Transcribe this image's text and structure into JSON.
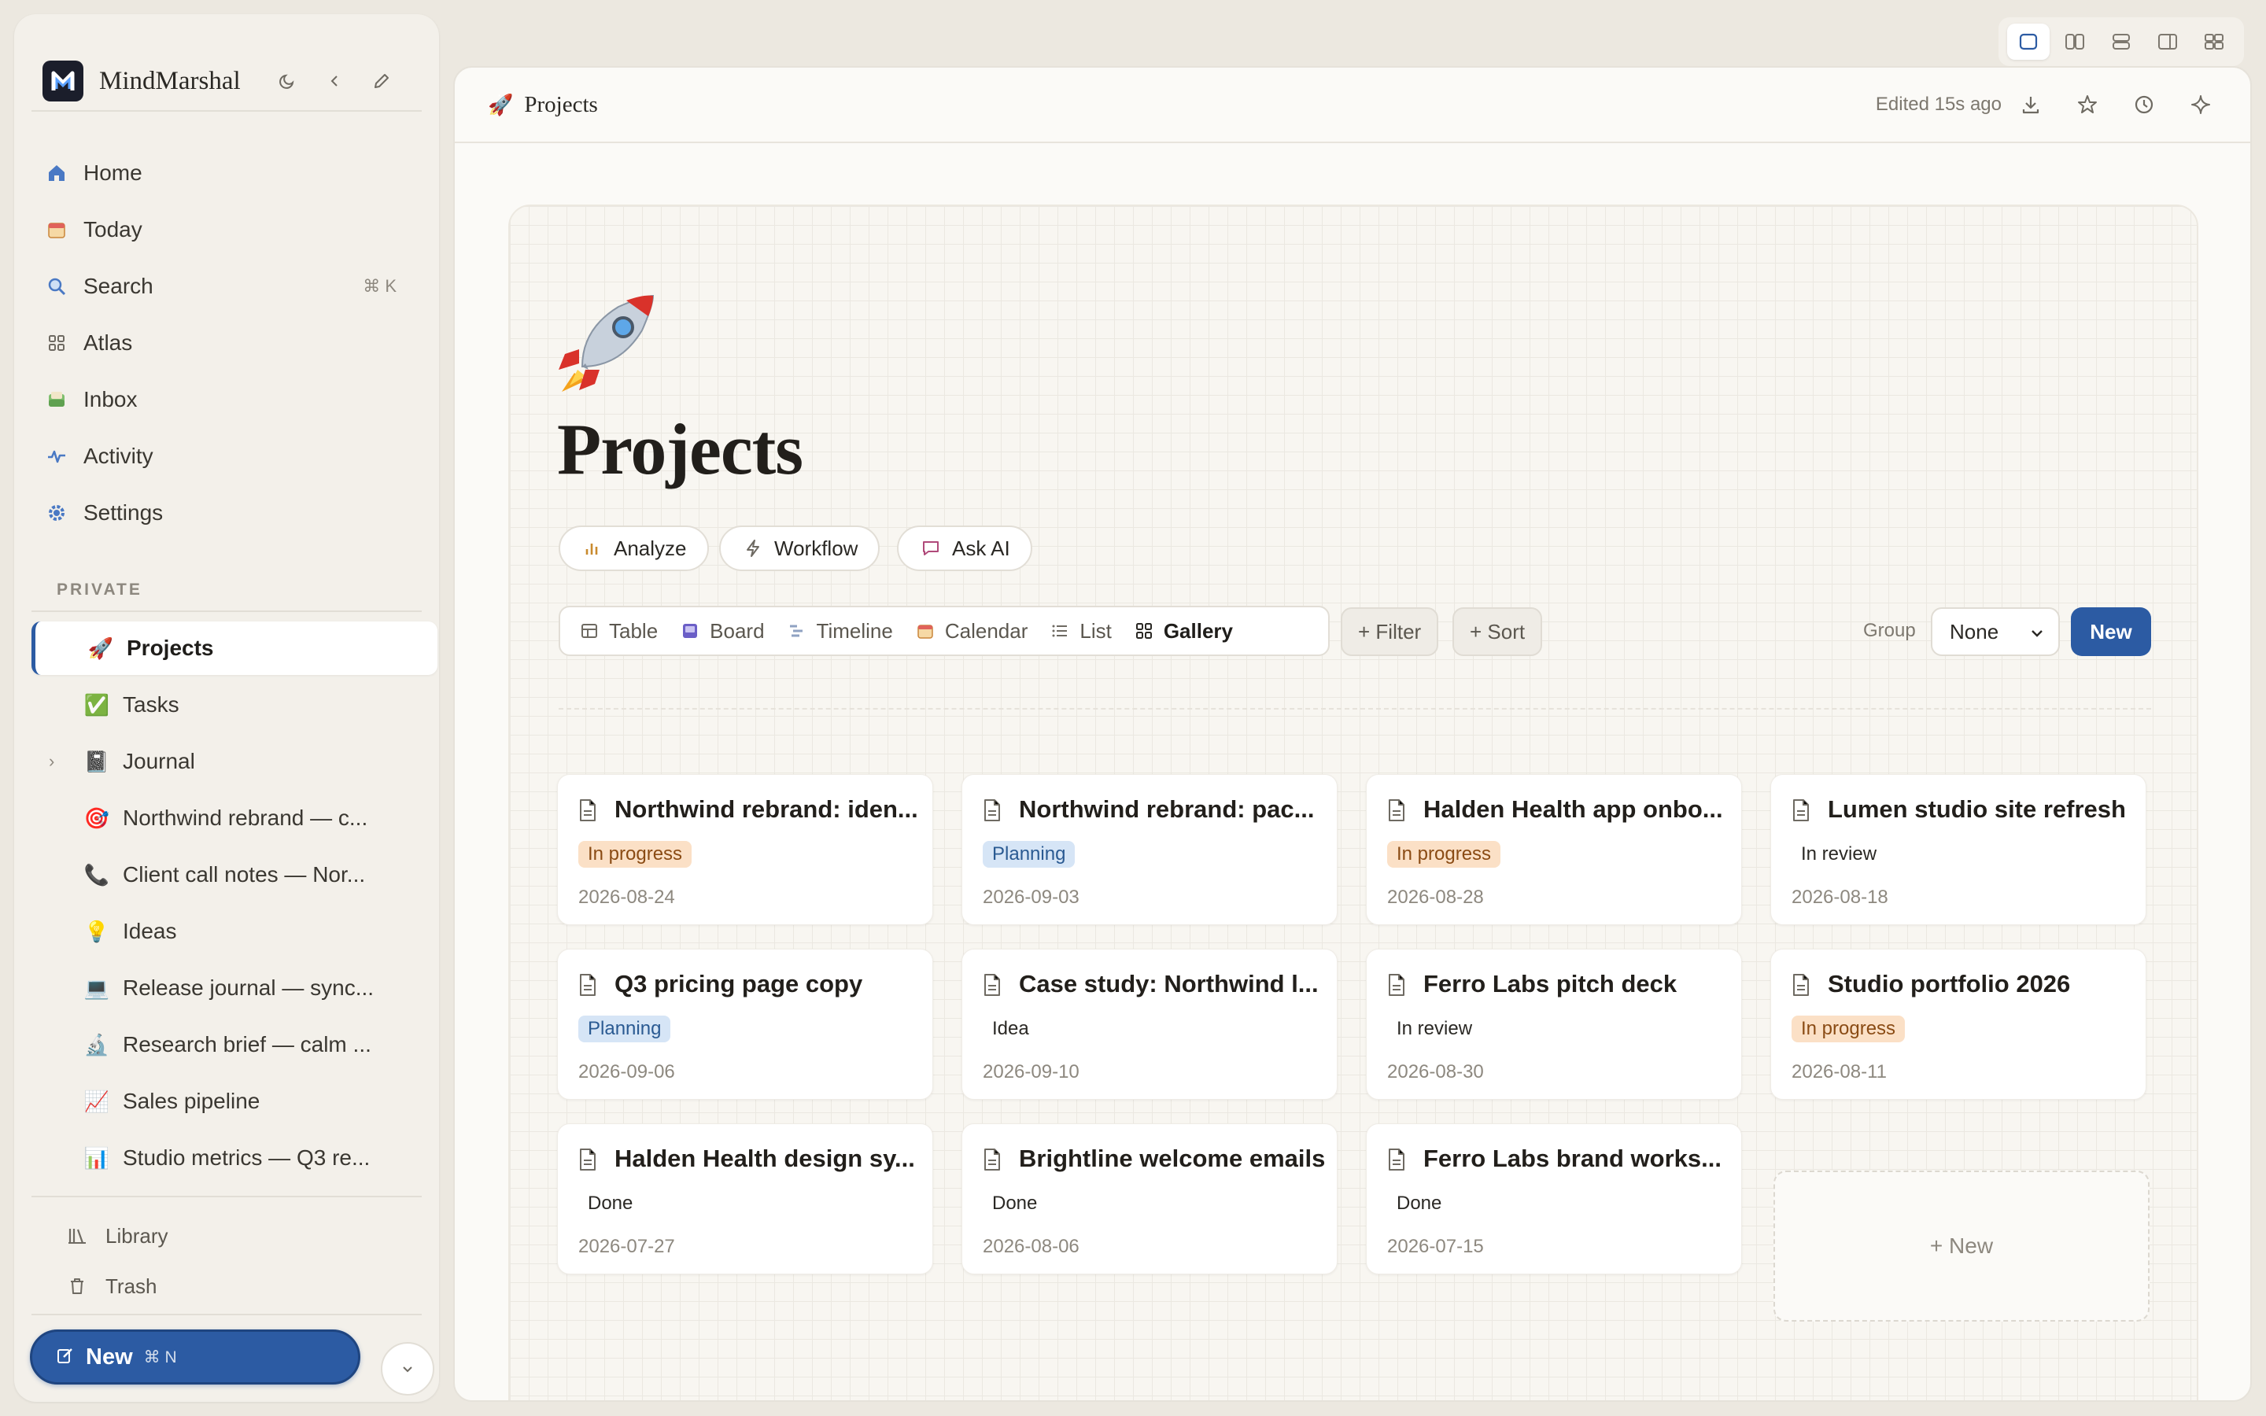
{
  "sidebar": {
    "brand": "MindMarshal",
    "nav": [
      {
        "label": "Home",
        "icon": "home-icon"
      },
      {
        "label": "Today",
        "icon": "calendar-icon"
      },
      {
        "label": "Search",
        "icon": "search-icon",
        "kbd": "⌘ K"
      },
      {
        "label": "Atlas",
        "icon": "grid-icon"
      },
      {
        "label": "Inbox",
        "icon": "inbox-icon"
      },
      {
        "label": "Activity",
        "icon": "activity-icon"
      },
      {
        "label": "Settings",
        "icon": "gear-icon"
      }
    ],
    "section_label": "PRIVATE",
    "pages": [
      {
        "label": "Projects",
        "emoji": "🚀",
        "active": true
      },
      {
        "label": "Tasks",
        "emoji": "✅"
      },
      {
        "label": "Journal",
        "emoji": "📓",
        "expandable": true
      },
      {
        "label": "Northwind rebrand — c...",
        "emoji": "🎯"
      },
      {
        "label": "Client call notes — Nor...",
        "emoji": "📞"
      },
      {
        "label": "Ideas",
        "emoji": "💡"
      },
      {
        "label": "Release journal — sync...",
        "emoji": "💻"
      },
      {
        "label": "Research brief — calm ...",
        "emoji": "🔬"
      },
      {
        "label": "Sales pipeline",
        "emoji": "📈"
      },
      {
        "label": "Studio metrics — Q3 re...",
        "emoji": "📊"
      }
    ],
    "footer": [
      {
        "label": "Library",
        "icon": "library-icon"
      },
      {
        "label": "Trash",
        "icon": "trash-icon"
      }
    ],
    "new_button": {
      "label": "New",
      "kbd": "⌘ N"
    }
  },
  "header": {
    "crumb_emoji": "🚀",
    "crumb": "Projects",
    "edited": "Edited 15s ago"
  },
  "page": {
    "title": "Projects",
    "actions": [
      {
        "label": "Analyze",
        "icon": "chart-icon"
      },
      {
        "label": "Workflow",
        "icon": "bolt-icon"
      },
      {
        "label": "Ask AI",
        "icon": "chat-icon"
      }
    ],
    "views": [
      {
        "label": "Table",
        "icon": "table-icon"
      },
      {
        "label": "Board",
        "icon": "board-icon"
      },
      {
        "label": "Timeline",
        "icon": "timeline-icon"
      },
      {
        "label": "Calendar",
        "icon": "calendar-icon"
      },
      {
        "label": "List",
        "icon": "list-icon"
      },
      {
        "label": "Gallery",
        "icon": "gallery-icon",
        "active": true
      }
    ],
    "filter": "+ Filter",
    "sort": "+ Sort",
    "group_label": "Group",
    "group_value": "None",
    "new_label": "New",
    "new_card": "+ New"
  },
  "cards": [
    {
      "title": "Northwind rebrand: iden...",
      "status": "In progress",
      "kind": "inprogress",
      "date": "2026-08-24"
    },
    {
      "title": "Northwind rebrand: pac...",
      "status": "Planning",
      "kind": "planning",
      "date": "2026-09-03"
    },
    {
      "title": "Halden Health app onbo...",
      "status": "In progress",
      "kind": "inprogress",
      "date": "2026-08-28"
    },
    {
      "title": "Lumen studio site refresh",
      "status": "In review",
      "kind": "plain",
      "date": "2026-08-18"
    },
    {
      "title": "Q3 pricing page copy",
      "status": "Planning",
      "kind": "planning",
      "date": "2026-09-06"
    },
    {
      "title": "Case study: Northwind l...",
      "status": "Idea",
      "kind": "plain",
      "date": "2026-09-10"
    },
    {
      "title": "Ferro Labs pitch deck",
      "status": "In review",
      "kind": "plain",
      "date": "2026-08-30"
    },
    {
      "title": "Studio portfolio 2026",
      "status": "In progress",
      "kind": "inprogress",
      "date": "2026-08-11"
    },
    {
      "title": "Halden Health design sy...",
      "status": "Done",
      "kind": "plain",
      "date": "2026-07-27"
    },
    {
      "title": "Brightline welcome emails",
      "status": "Done",
      "kind": "plain",
      "date": "2026-08-06"
    },
    {
      "title": "Ferro Labs brand works...",
      "status": "Done",
      "kind": "plain",
      "date": "2026-07-15"
    }
  ],
  "colors": {
    "accent": "#2c5ba3",
    "inprogress_bg": "#fbe0c6",
    "planning_bg": "#d6e5f6"
  }
}
